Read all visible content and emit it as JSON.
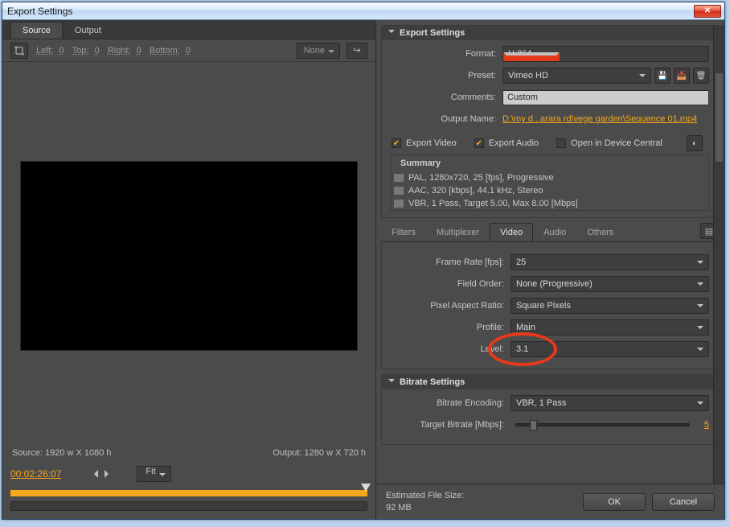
{
  "window": {
    "title": "Export Settings"
  },
  "left": {
    "tabs": {
      "source": "Source",
      "output": "Output"
    },
    "crop": {
      "left_l": "Left:",
      "left_v": "0",
      "top_l": "Top:",
      "top_v": "0",
      "right_l": "Right:",
      "right_v": "0",
      "bottom_l": "Bottom:",
      "bottom_v": "0",
      "mode": "None"
    },
    "source_dims": "Source: 1920 w X 1080 h",
    "output_dims": "Output: 1280 w X 720 h",
    "timecode": "00:02:26:07",
    "zoom": "Fit"
  },
  "export": {
    "section_title": "Export Settings",
    "format_l": "Format:",
    "format_v": "H.264",
    "preset_l": "Preset:",
    "preset_v": "Vimeo HD",
    "comments_l": "Comments:",
    "comments_v": "Custom",
    "outputname_l": "Output Name:",
    "outputname_v": "D:\\my d...arara rd\\vege garden\\Sequence 01.mp4",
    "cb_video": "Export Video",
    "cb_audio": "Export Audio",
    "cb_device": "Open in Device Central",
    "summary_title": "Summary",
    "summary": {
      "l1": "PAL, 1280x720, 25 [fps], Progressive",
      "l2": "AAC, 320 [kbps], 44.1 kHz, Stereo",
      "l3": "VBR, 1 Pass, Target 5.00, Max 8.00 [Mbps]"
    }
  },
  "subtabs": {
    "filters": "Filters",
    "multiplexer": "Multiplexer",
    "video": "Video",
    "audio": "Audio",
    "others": "Others"
  },
  "video": {
    "framerate_l": "Frame Rate [fps]:",
    "framerate_v": "25",
    "fieldorder_l": "Field Order:",
    "fieldorder_v": "None (Progressive)",
    "par_l": "Pixel Aspect Ratio:",
    "par_v": "Square Pixels",
    "profile_l": "Profile:",
    "profile_v": "Main",
    "level_l": "Level:",
    "level_v": "3.1"
  },
  "bitrate": {
    "section_title": "Bitrate Settings",
    "encoding_l": "Bitrate Encoding:",
    "encoding_v": "VBR, 1 Pass",
    "target_l": "Target Bitrate [Mbps]:",
    "target_v": "5"
  },
  "footer": {
    "filesize_l": "Estimated File Size:",
    "filesize_v": "92 MB",
    "ok": "OK",
    "cancel": "Cancel"
  }
}
